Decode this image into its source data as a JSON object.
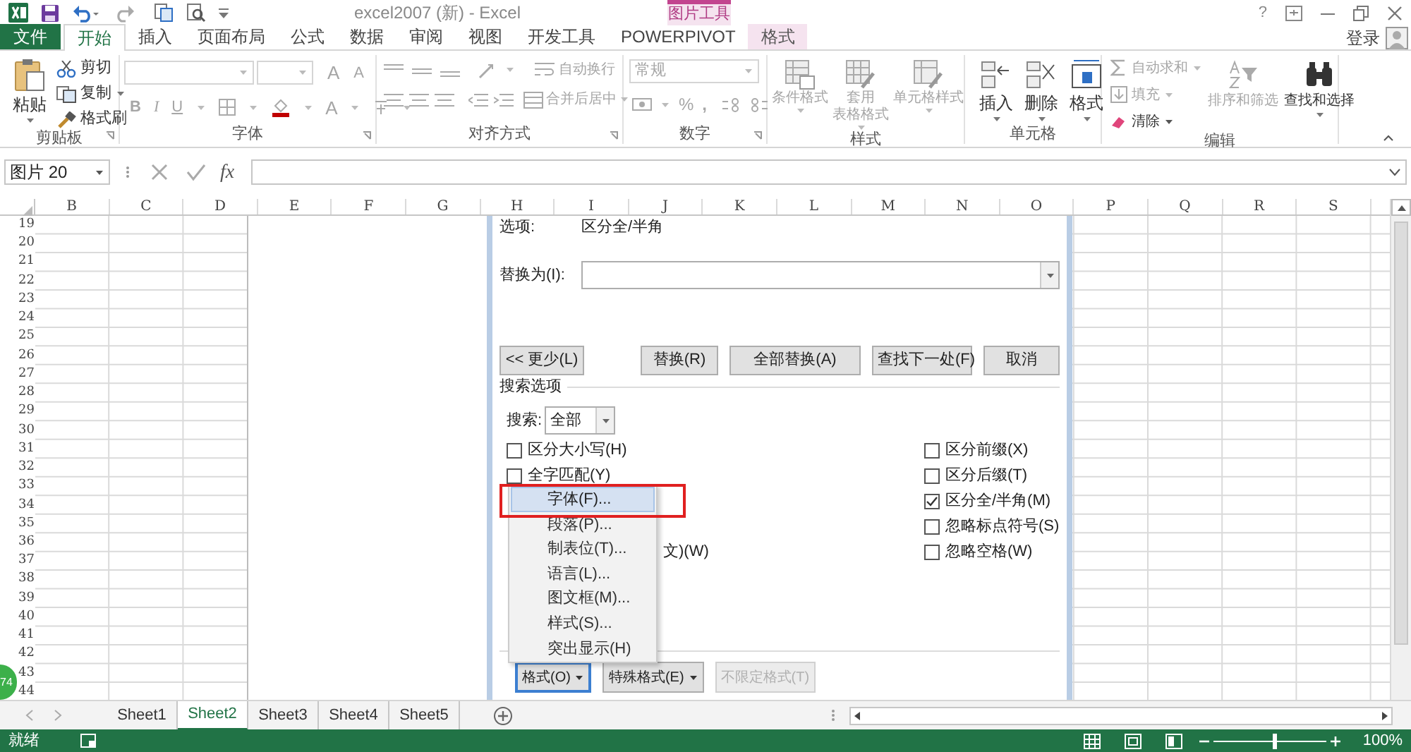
{
  "title_bar": {
    "title": "excel2007 (新) - Excel",
    "context_header": "图片工具",
    "help": "?"
  },
  "tabs": [
    {
      "label": "文件",
      "kind": "file",
      "selected": false
    },
    {
      "label": "开始",
      "kind": "normal",
      "selected": true
    },
    {
      "label": "插入",
      "kind": "normal",
      "selected": false
    },
    {
      "label": "页面布局",
      "kind": "normal",
      "selected": false
    },
    {
      "label": "公式",
      "kind": "normal",
      "selected": false
    },
    {
      "label": "数据",
      "kind": "normal",
      "selected": false
    },
    {
      "label": "审阅",
      "kind": "normal",
      "selected": false
    },
    {
      "label": "视图",
      "kind": "normal",
      "selected": false
    },
    {
      "label": "开发工具",
      "kind": "normal",
      "selected": false
    },
    {
      "label": "POWERPIVOT",
      "kind": "normal",
      "selected": false
    },
    {
      "label": "格式",
      "kind": "context",
      "selected": false
    }
  ],
  "account": "登录",
  "ribbon": {
    "clipboard": {
      "label": "剪贴板",
      "paste": "粘贴",
      "items": [
        {
          "label": "剪切",
          "disabled": false
        },
        {
          "label": "复制",
          "disabled": false
        },
        {
          "label": "格式刷",
          "disabled": false
        }
      ]
    },
    "font": {
      "label": "字体",
      "grow": "A",
      "shrink": "A",
      "bold": "B",
      "italic": "I",
      "underline": "U",
      "font_color_label": "A",
      "disabled": true
    },
    "alignment": {
      "label": "对齐方式",
      "items": [
        {
          "label": "自动换行",
          "disabled": true
        },
        {
          "label": "合并后居中",
          "disabled": true
        }
      ]
    },
    "number": {
      "label": "数字",
      "format": "常规",
      "percent": "%",
      "comma": ",",
      "disabled": true
    },
    "styles": {
      "label": "样式",
      "items": [
        {
          "lines": [
            "条件格式"
          ],
          "disabled": true
        },
        {
          "lines": [
            "套用",
            "表格格式"
          ],
          "disabled": true
        },
        {
          "lines": [
            "单元格样式"
          ],
          "disabled": true
        }
      ]
    },
    "cells": {
      "label": "单元格",
      "items": [
        {
          "label": "插入",
          "disabled": false
        },
        {
          "label": "删除",
          "disabled": false
        },
        {
          "label": "格式",
          "disabled": false
        }
      ]
    },
    "editing": {
      "label": "编辑",
      "small": [
        {
          "label": "自动求和",
          "disabled": true
        },
        {
          "label": "填充",
          "disabled": true
        },
        {
          "label": "清除",
          "disabled": false
        }
      ],
      "large": [
        {
          "label": "排序和筛选",
          "disabled": true
        },
        {
          "label": "查找和选择",
          "disabled": false
        }
      ]
    }
  },
  "formula_bar": {
    "name_box": "图片 20",
    "fx": "fx"
  },
  "columns": [
    "B",
    "C",
    "D",
    "E",
    "F",
    "G",
    "H",
    "I",
    "J",
    "K",
    "L",
    "M",
    "N",
    "O",
    "P",
    "Q",
    "R",
    "S"
  ],
  "rows": [
    "19",
    "20",
    "21",
    "22",
    "23",
    "24",
    "25",
    "26",
    "27",
    "28",
    "29",
    "30",
    "31",
    "32",
    "33",
    "34",
    "35",
    "36",
    "37",
    "38",
    "39",
    "40",
    "41",
    "42",
    "43",
    "44"
  ],
  "dialog": {
    "option_label": "选项:",
    "option_value": "区分全/半角",
    "replace_label": "替换为(I):",
    "buttons": [
      "<< 更少(L)",
      "替换(R)",
      "全部替换(A)",
      "查找下一处(F)",
      "取消"
    ],
    "search_options_title": "搜索选项",
    "search_label": "搜索:",
    "search_value": "全部",
    "left_options": [
      {
        "label": "区分大小写(H)",
        "checked": false
      },
      {
        "label": "全字匹配(Y)",
        "checked": false
      }
    ],
    "covered_option_tail": "文)(W)",
    "right_options": [
      {
        "label": "区分前缀(X)",
        "checked": false
      },
      {
        "label": "区分后缀(T)",
        "checked": false
      },
      {
        "label": "区分全/半角(M)",
        "checked": true
      },
      {
        "label": "忽略标点符号(S)",
        "checked": false
      },
      {
        "label": "忽略空格(W)",
        "checked": false
      }
    ],
    "bottom_buttons": [
      {
        "label": "格式(O)",
        "dropdown": true,
        "disabled": false,
        "focused": true
      },
      {
        "label": "特殊格式(E)",
        "dropdown": true,
        "disabled": false,
        "focused": false
      },
      {
        "label": "不限定格式(T)",
        "dropdown": false,
        "disabled": true,
        "focused": false
      }
    ]
  },
  "format_menu": [
    {
      "label": "字体(F)...",
      "selected": true
    },
    {
      "label": "段落(P)...",
      "selected": false
    },
    {
      "label": "制表位(T)...",
      "selected": false
    },
    {
      "label": "语言(L)...",
      "selected": false
    },
    {
      "label": "图文框(M)...",
      "selected": false
    },
    {
      "label": "样式(S)...",
      "selected": false
    },
    {
      "label": "突出显示(H)",
      "selected": false
    }
  ],
  "badge": "74",
  "sheets": [
    {
      "label": "Sheet1",
      "selected": false
    },
    {
      "label": "Sheet2",
      "selected": true
    },
    {
      "label": "Sheet3",
      "selected": false
    },
    {
      "label": "Sheet4",
      "selected": false
    },
    {
      "label": "Sheet5",
      "selected": false
    }
  ],
  "status_bar": {
    "text": "就绪",
    "zoom": "100%",
    "level": 0.55
  }
}
